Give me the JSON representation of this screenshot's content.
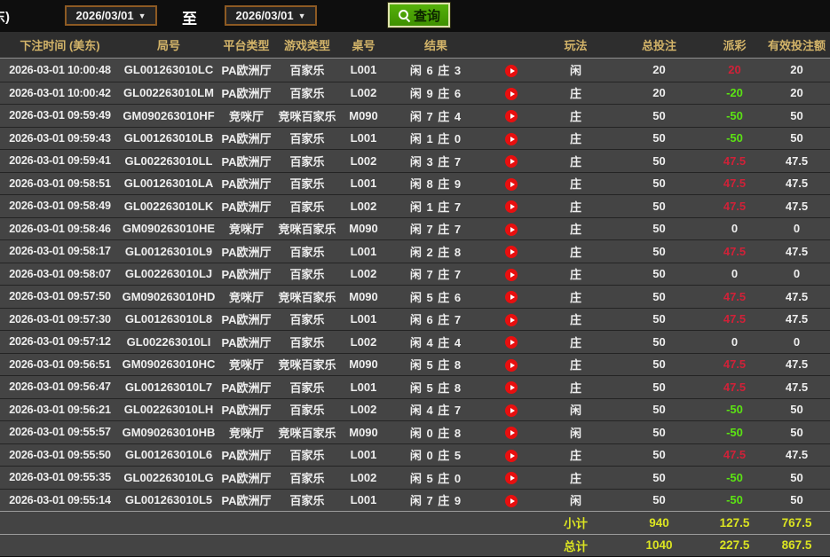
{
  "toolbar": {
    "clipped_label": "东)",
    "date_from": "2026/03/01",
    "date_to": "2026/03/01",
    "dropdown_arrow": "▼",
    "to_label": "至",
    "query_label": "查询"
  },
  "icons": {
    "search_icon": "magnifier",
    "dropdown_icon": "chevron-down",
    "play_icon": "play-circle-red"
  },
  "colors": {
    "header_text_gold": "#d3b469",
    "positive_payout_red": "#d12138",
    "negative_payout_green": "#5be313",
    "total_row_yellow": "#dbe421",
    "query_button_green": "#4aa206",
    "date_box_border": "#8d5a23",
    "row_background": "#444444"
  },
  "table": {
    "headers": [
      "下注时间 (美东)",
      "局号",
      "平台类型",
      "游戏类型",
      "桌号",
      "结果",
      "玩法",
      "总投注",
      "派彩",
      "有效投注额"
    ],
    "rows": [
      {
        "time": "2026-03-01 10:00:48",
        "round": "GL001263010LC",
        "platform": "PA欧洲厅",
        "game": "百家乐",
        "table_no": "L001",
        "result": "闲 6 庄 3",
        "bet": "闲",
        "total": "20",
        "payout": "20",
        "valid": "20",
        "payout_sign": "pos"
      },
      {
        "time": "2026-03-01 10:00:42",
        "round": "GL002263010LM",
        "platform": "PA欧洲厅",
        "game": "百家乐",
        "table_no": "L002",
        "result": "闲 9 庄 6",
        "bet": "庄",
        "total": "20",
        "payout": "-20",
        "valid": "20",
        "payout_sign": "neg"
      },
      {
        "time": "2026-03-01 09:59:49",
        "round": "GM090263010HF",
        "platform": "竞咪厅",
        "game": "竞咪百家乐",
        "table_no": "M090",
        "result": "闲 7 庄 4",
        "bet": "庄",
        "total": "50",
        "payout": "-50",
        "valid": "50",
        "payout_sign": "neg"
      },
      {
        "time": "2026-03-01 09:59:43",
        "round": "GL001263010LB",
        "platform": "PA欧洲厅",
        "game": "百家乐",
        "table_no": "L001",
        "result": "闲 1 庄 0",
        "bet": "庄",
        "total": "50",
        "payout": "-50",
        "valid": "50",
        "payout_sign": "neg"
      },
      {
        "time": "2026-03-01 09:59:41",
        "round": "GL002263010LL",
        "platform": "PA欧洲厅",
        "game": "百家乐",
        "table_no": "L002",
        "result": "闲 3 庄 7",
        "bet": "庄",
        "total": "50",
        "payout": "47.5",
        "valid": "47.5",
        "payout_sign": "pos"
      },
      {
        "time": "2026-03-01 09:58:51",
        "round": "GL001263010LA",
        "platform": "PA欧洲厅",
        "game": "百家乐",
        "table_no": "L001",
        "result": "闲 8 庄 9",
        "bet": "庄",
        "total": "50",
        "payout": "47.5",
        "valid": "47.5",
        "payout_sign": "pos"
      },
      {
        "time": "2026-03-01 09:58:49",
        "round": "GL002263010LK",
        "platform": "PA欧洲厅",
        "game": "百家乐",
        "table_no": "L002",
        "result": "闲 1 庄 7",
        "bet": "庄",
        "total": "50",
        "payout": "47.5",
        "valid": "47.5",
        "payout_sign": "pos"
      },
      {
        "time": "2026-03-01 09:58:46",
        "round": "GM090263010HE",
        "platform": "竞咪厅",
        "game": "竞咪百家乐",
        "table_no": "M090",
        "result": "闲 7 庄 7",
        "bet": "庄",
        "total": "50",
        "payout": "0",
        "valid": "0",
        "payout_sign": "zero"
      },
      {
        "time": "2026-03-01 09:58:17",
        "round": "GL001263010L9",
        "platform": "PA欧洲厅",
        "game": "百家乐",
        "table_no": "L001",
        "result": "闲 2 庄 8",
        "bet": "庄",
        "total": "50",
        "payout": "47.5",
        "valid": "47.5",
        "payout_sign": "pos"
      },
      {
        "time": "2026-03-01 09:58:07",
        "round": "GL002263010LJ",
        "platform": "PA欧洲厅",
        "game": "百家乐",
        "table_no": "L002",
        "result": "闲 7 庄 7",
        "bet": "庄",
        "total": "50",
        "payout": "0",
        "valid": "0",
        "payout_sign": "zero"
      },
      {
        "time": "2026-03-01 09:57:50",
        "round": "GM090263010HD",
        "platform": "竞咪厅",
        "game": "竞咪百家乐",
        "table_no": "M090",
        "result": "闲 5 庄 6",
        "bet": "庄",
        "total": "50",
        "payout": "47.5",
        "valid": "47.5",
        "payout_sign": "pos"
      },
      {
        "time": "2026-03-01 09:57:30",
        "round": "GL001263010L8",
        "platform": "PA欧洲厅",
        "game": "百家乐",
        "table_no": "L001",
        "result": "闲 6 庄 7",
        "bet": "庄",
        "total": "50",
        "payout": "47.5",
        "valid": "47.5",
        "payout_sign": "pos"
      },
      {
        "time": "2026-03-01 09:57:12",
        "round": "GL002263010LI",
        "platform": "PA欧洲厅",
        "game": "百家乐",
        "table_no": "L002",
        "result": "闲 4 庄 4",
        "bet": "庄",
        "total": "50",
        "payout": "0",
        "valid": "0",
        "payout_sign": "zero"
      },
      {
        "time": "2026-03-01 09:56:51",
        "round": "GM090263010HC",
        "platform": "竞咪厅",
        "game": "竞咪百家乐",
        "table_no": "M090",
        "result": "闲 5 庄 8",
        "bet": "庄",
        "total": "50",
        "payout": "47.5",
        "valid": "47.5",
        "payout_sign": "pos"
      },
      {
        "time": "2026-03-01 09:56:47",
        "round": "GL001263010L7",
        "platform": "PA欧洲厅",
        "game": "百家乐",
        "table_no": "L001",
        "result": "闲 5 庄 8",
        "bet": "庄",
        "total": "50",
        "payout": "47.5",
        "valid": "47.5",
        "payout_sign": "pos"
      },
      {
        "time": "2026-03-01 09:56:21",
        "round": "GL002263010LH",
        "platform": "PA欧洲厅",
        "game": "百家乐",
        "table_no": "L002",
        "result": "闲 4 庄 7",
        "bet": "闲",
        "total": "50",
        "payout": "-50",
        "valid": "50",
        "payout_sign": "neg"
      },
      {
        "time": "2026-03-01 09:55:57",
        "round": "GM090263010HB",
        "platform": "竞咪厅",
        "game": "竞咪百家乐",
        "table_no": "M090",
        "result": "闲 0 庄 8",
        "bet": "闲",
        "total": "50",
        "payout": "-50",
        "valid": "50",
        "payout_sign": "neg"
      },
      {
        "time": "2026-03-01 09:55:50",
        "round": "GL001263010L6",
        "platform": "PA欧洲厅",
        "game": "百家乐",
        "table_no": "L001",
        "result": "闲 0 庄 5",
        "bet": "庄",
        "total": "50",
        "payout": "47.5",
        "valid": "47.5",
        "payout_sign": "pos"
      },
      {
        "time": "2026-03-01 09:55:35",
        "round": "GL002263010LG",
        "platform": "PA欧洲厅",
        "game": "百家乐",
        "table_no": "L002",
        "result": "闲 5 庄 0",
        "bet": "庄",
        "total": "50",
        "payout": "-50",
        "valid": "50",
        "payout_sign": "neg"
      },
      {
        "time": "2026-03-01 09:55:14",
        "round": "GL001263010L5",
        "platform": "PA欧洲厅",
        "game": "百家乐",
        "table_no": "L001",
        "result": "闲 7 庄 9",
        "bet": "闲",
        "total": "50",
        "payout": "-50",
        "valid": "50",
        "payout_sign": "neg"
      }
    ],
    "subtotal": {
      "label": "小计",
      "total": "940",
      "payout": "127.5",
      "valid": "767.5"
    },
    "grand_total": {
      "label": "总计",
      "total": "1040",
      "payout": "227.5",
      "valid": "867.5"
    }
  }
}
